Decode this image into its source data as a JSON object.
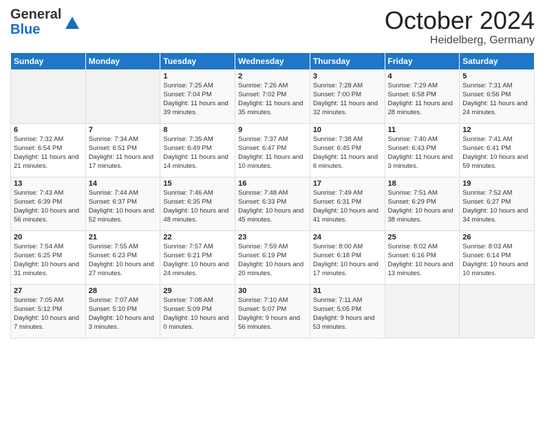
{
  "header": {
    "logo_general": "General",
    "logo_blue": "Blue",
    "month_title": "October 2024",
    "location": "Heidelberg, Germany"
  },
  "days_of_week": [
    "Sunday",
    "Monday",
    "Tuesday",
    "Wednesday",
    "Thursday",
    "Friday",
    "Saturday"
  ],
  "weeks": [
    [
      {
        "day": "",
        "sunrise": "",
        "sunset": "",
        "daylight": ""
      },
      {
        "day": "",
        "sunrise": "",
        "sunset": "",
        "daylight": ""
      },
      {
        "day": "1",
        "sunrise": "Sunrise: 7:25 AM",
        "sunset": "Sunset: 7:04 PM",
        "daylight": "Daylight: 11 hours and 39 minutes."
      },
      {
        "day": "2",
        "sunrise": "Sunrise: 7:26 AM",
        "sunset": "Sunset: 7:02 PM",
        "daylight": "Daylight: 11 hours and 35 minutes."
      },
      {
        "day": "3",
        "sunrise": "Sunrise: 7:28 AM",
        "sunset": "Sunset: 7:00 PM",
        "daylight": "Daylight: 11 hours and 32 minutes."
      },
      {
        "day": "4",
        "sunrise": "Sunrise: 7:29 AM",
        "sunset": "Sunset: 6:58 PM",
        "daylight": "Daylight: 11 hours and 28 minutes."
      },
      {
        "day": "5",
        "sunrise": "Sunrise: 7:31 AM",
        "sunset": "Sunset: 6:56 PM",
        "daylight": "Daylight: 11 hours and 24 minutes."
      }
    ],
    [
      {
        "day": "6",
        "sunrise": "Sunrise: 7:32 AM",
        "sunset": "Sunset: 6:54 PM",
        "daylight": "Daylight: 11 hours and 21 minutes."
      },
      {
        "day": "7",
        "sunrise": "Sunrise: 7:34 AM",
        "sunset": "Sunset: 6:51 PM",
        "daylight": "Daylight: 11 hours and 17 minutes."
      },
      {
        "day": "8",
        "sunrise": "Sunrise: 7:35 AM",
        "sunset": "Sunset: 6:49 PM",
        "daylight": "Daylight: 11 hours and 14 minutes."
      },
      {
        "day": "9",
        "sunrise": "Sunrise: 7:37 AM",
        "sunset": "Sunset: 6:47 PM",
        "daylight": "Daylight: 11 hours and 10 minutes."
      },
      {
        "day": "10",
        "sunrise": "Sunrise: 7:38 AM",
        "sunset": "Sunset: 6:45 PM",
        "daylight": "Daylight: 11 hours and 6 minutes."
      },
      {
        "day": "11",
        "sunrise": "Sunrise: 7:40 AM",
        "sunset": "Sunset: 6:43 PM",
        "daylight": "Daylight: 11 hours and 3 minutes."
      },
      {
        "day": "12",
        "sunrise": "Sunrise: 7:41 AM",
        "sunset": "Sunset: 6:41 PM",
        "daylight": "Daylight: 10 hours and 59 minutes."
      }
    ],
    [
      {
        "day": "13",
        "sunrise": "Sunrise: 7:43 AM",
        "sunset": "Sunset: 6:39 PM",
        "daylight": "Daylight: 10 hours and 56 minutes."
      },
      {
        "day": "14",
        "sunrise": "Sunrise: 7:44 AM",
        "sunset": "Sunset: 6:37 PM",
        "daylight": "Daylight: 10 hours and 52 minutes."
      },
      {
        "day": "15",
        "sunrise": "Sunrise: 7:46 AM",
        "sunset": "Sunset: 6:35 PM",
        "daylight": "Daylight: 10 hours and 48 minutes."
      },
      {
        "day": "16",
        "sunrise": "Sunrise: 7:48 AM",
        "sunset": "Sunset: 6:33 PM",
        "daylight": "Daylight: 10 hours and 45 minutes."
      },
      {
        "day": "17",
        "sunrise": "Sunrise: 7:49 AM",
        "sunset": "Sunset: 6:31 PM",
        "daylight": "Daylight: 10 hours and 41 minutes."
      },
      {
        "day": "18",
        "sunrise": "Sunrise: 7:51 AM",
        "sunset": "Sunset: 6:29 PM",
        "daylight": "Daylight: 10 hours and 38 minutes."
      },
      {
        "day": "19",
        "sunrise": "Sunrise: 7:52 AM",
        "sunset": "Sunset: 6:27 PM",
        "daylight": "Daylight: 10 hours and 34 minutes."
      }
    ],
    [
      {
        "day": "20",
        "sunrise": "Sunrise: 7:54 AM",
        "sunset": "Sunset: 6:25 PM",
        "daylight": "Daylight: 10 hours and 31 minutes."
      },
      {
        "day": "21",
        "sunrise": "Sunrise: 7:55 AM",
        "sunset": "Sunset: 6:23 PM",
        "daylight": "Daylight: 10 hours and 27 minutes."
      },
      {
        "day": "22",
        "sunrise": "Sunrise: 7:57 AM",
        "sunset": "Sunset: 6:21 PM",
        "daylight": "Daylight: 10 hours and 24 minutes."
      },
      {
        "day": "23",
        "sunrise": "Sunrise: 7:59 AM",
        "sunset": "Sunset: 6:19 PM",
        "daylight": "Daylight: 10 hours and 20 minutes."
      },
      {
        "day": "24",
        "sunrise": "Sunrise: 8:00 AM",
        "sunset": "Sunset: 6:18 PM",
        "daylight": "Daylight: 10 hours and 17 minutes."
      },
      {
        "day": "25",
        "sunrise": "Sunrise: 8:02 AM",
        "sunset": "Sunset: 6:16 PM",
        "daylight": "Daylight: 10 hours and 13 minutes."
      },
      {
        "day": "26",
        "sunrise": "Sunrise: 8:03 AM",
        "sunset": "Sunset: 6:14 PM",
        "daylight": "Daylight: 10 hours and 10 minutes."
      }
    ],
    [
      {
        "day": "27",
        "sunrise": "Sunrise: 7:05 AM",
        "sunset": "Sunset: 5:12 PM",
        "daylight": "Daylight: 10 hours and 7 minutes."
      },
      {
        "day": "28",
        "sunrise": "Sunrise: 7:07 AM",
        "sunset": "Sunset: 5:10 PM",
        "daylight": "Daylight: 10 hours and 3 minutes."
      },
      {
        "day": "29",
        "sunrise": "Sunrise: 7:08 AM",
        "sunset": "Sunset: 5:09 PM",
        "daylight": "Daylight: 10 hours and 0 minutes."
      },
      {
        "day": "30",
        "sunrise": "Sunrise: 7:10 AM",
        "sunset": "Sunset: 5:07 PM",
        "daylight": "Daylight: 9 hours and 56 minutes."
      },
      {
        "day": "31",
        "sunrise": "Sunrise: 7:11 AM",
        "sunset": "Sunset: 5:05 PM",
        "daylight": "Daylight: 9 hours and 53 minutes."
      },
      {
        "day": "",
        "sunrise": "",
        "sunset": "",
        "daylight": ""
      },
      {
        "day": "",
        "sunrise": "",
        "sunset": "",
        "daylight": ""
      }
    ]
  ]
}
